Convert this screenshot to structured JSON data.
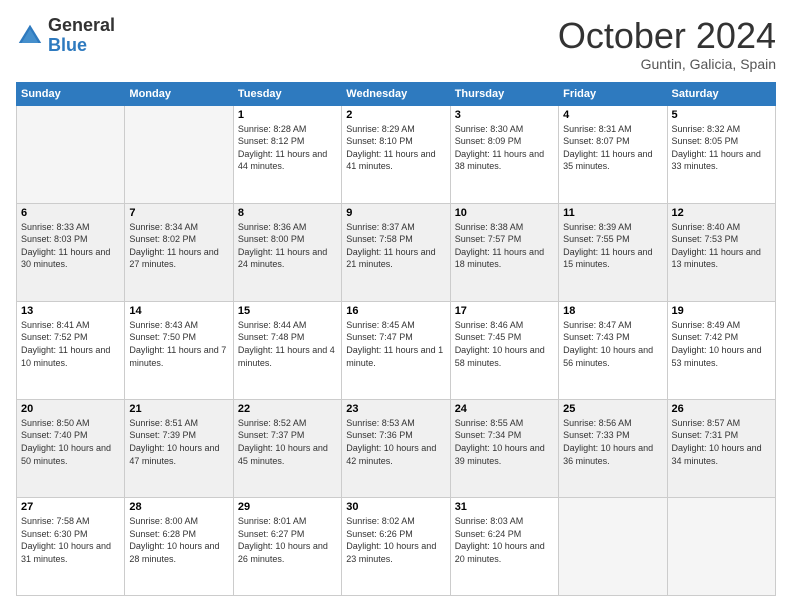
{
  "logo": {
    "general": "General",
    "blue": "Blue"
  },
  "header": {
    "month": "October 2024",
    "location": "Guntin, Galicia, Spain"
  },
  "weekdays": [
    "Sunday",
    "Monday",
    "Tuesday",
    "Wednesday",
    "Thursday",
    "Friday",
    "Saturday"
  ],
  "days": [
    {
      "num": "",
      "info": ""
    },
    {
      "num": "",
      "info": ""
    },
    {
      "num": "1",
      "info": "Sunrise: 8:28 AM\nSunset: 8:12 PM\nDaylight: 11 hours and 44 minutes."
    },
    {
      "num": "2",
      "info": "Sunrise: 8:29 AM\nSunset: 8:10 PM\nDaylight: 11 hours and 41 minutes."
    },
    {
      "num": "3",
      "info": "Sunrise: 8:30 AM\nSunset: 8:09 PM\nDaylight: 11 hours and 38 minutes."
    },
    {
      "num": "4",
      "info": "Sunrise: 8:31 AM\nSunset: 8:07 PM\nDaylight: 11 hours and 35 minutes."
    },
    {
      "num": "5",
      "info": "Sunrise: 8:32 AM\nSunset: 8:05 PM\nDaylight: 11 hours and 33 minutes."
    },
    {
      "num": "6",
      "info": "Sunrise: 8:33 AM\nSunset: 8:03 PM\nDaylight: 11 hours and 30 minutes."
    },
    {
      "num": "7",
      "info": "Sunrise: 8:34 AM\nSunset: 8:02 PM\nDaylight: 11 hours and 27 minutes."
    },
    {
      "num": "8",
      "info": "Sunrise: 8:36 AM\nSunset: 8:00 PM\nDaylight: 11 hours and 24 minutes."
    },
    {
      "num": "9",
      "info": "Sunrise: 8:37 AM\nSunset: 7:58 PM\nDaylight: 11 hours and 21 minutes."
    },
    {
      "num": "10",
      "info": "Sunrise: 8:38 AM\nSunset: 7:57 PM\nDaylight: 11 hours and 18 minutes."
    },
    {
      "num": "11",
      "info": "Sunrise: 8:39 AM\nSunset: 7:55 PM\nDaylight: 11 hours and 15 minutes."
    },
    {
      "num": "12",
      "info": "Sunrise: 8:40 AM\nSunset: 7:53 PM\nDaylight: 11 hours and 13 minutes."
    },
    {
      "num": "13",
      "info": "Sunrise: 8:41 AM\nSunset: 7:52 PM\nDaylight: 11 hours and 10 minutes."
    },
    {
      "num": "14",
      "info": "Sunrise: 8:43 AM\nSunset: 7:50 PM\nDaylight: 11 hours and 7 minutes."
    },
    {
      "num": "15",
      "info": "Sunrise: 8:44 AM\nSunset: 7:48 PM\nDaylight: 11 hours and 4 minutes."
    },
    {
      "num": "16",
      "info": "Sunrise: 8:45 AM\nSunset: 7:47 PM\nDaylight: 11 hours and 1 minute."
    },
    {
      "num": "17",
      "info": "Sunrise: 8:46 AM\nSunset: 7:45 PM\nDaylight: 10 hours and 58 minutes."
    },
    {
      "num": "18",
      "info": "Sunrise: 8:47 AM\nSunset: 7:43 PM\nDaylight: 10 hours and 56 minutes."
    },
    {
      "num": "19",
      "info": "Sunrise: 8:49 AM\nSunset: 7:42 PM\nDaylight: 10 hours and 53 minutes."
    },
    {
      "num": "20",
      "info": "Sunrise: 8:50 AM\nSunset: 7:40 PM\nDaylight: 10 hours and 50 minutes."
    },
    {
      "num": "21",
      "info": "Sunrise: 8:51 AM\nSunset: 7:39 PM\nDaylight: 10 hours and 47 minutes."
    },
    {
      "num": "22",
      "info": "Sunrise: 8:52 AM\nSunset: 7:37 PM\nDaylight: 10 hours and 45 minutes."
    },
    {
      "num": "23",
      "info": "Sunrise: 8:53 AM\nSunset: 7:36 PM\nDaylight: 10 hours and 42 minutes."
    },
    {
      "num": "24",
      "info": "Sunrise: 8:55 AM\nSunset: 7:34 PM\nDaylight: 10 hours and 39 minutes."
    },
    {
      "num": "25",
      "info": "Sunrise: 8:56 AM\nSunset: 7:33 PM\nDaylight: 10 hours and 36 minutes."
    },
    {
      "num": "26",
      "info": "Sunrise: 8:57 AM\nSunset: 7:31 PM\nDaylight: 10 hours and 34 minutes."
    },
    {
      "num": "27",
      "info": "Sunrise: 7:58 AM\nSunset: 6:30 PM\nDaylight: 10 hours and 31 minutes."
    },
    {
      "num": "28",
      "info": "Sunrise: 8:00 AM\nSunset: 6:28 PM\nDaylight: 10 hours and 28 minutes."
    },
    {
      "num": "29",
      "info": "Sunrise: 8:01 AM\nSunset: 6:27 PM\nDaylight: 10 hours and 26 minutes."
    },
    {
      "num": "30",
      "info": "Sunrise: 8:02 AM\nSunset: 6:26 PM\nDaylight: 10 hours and 23 minutes."
    },
    {
      "num": "31",
      "info": "Sunrise: 8:03 AM\nSunset: 6:24 PM\nDaylight: 10 hours and 20 minutes."
    },
    {
      "num": "",
      "info": ""
    },
    {
      "num": "",
      "info": ""
    }
  ]
}
